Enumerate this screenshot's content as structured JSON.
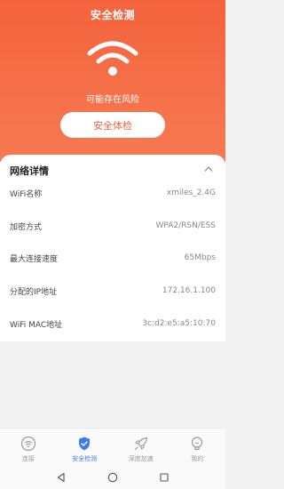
{
  "header": {
    "title": "安全检测",
    "status": "可能存在风险",
    "check_button": "安全体检"
  },
  "details": {
    "title": "网络详情",
    "rows": [
      {
        "key": "WiFi名称",
        "value": "xmiles_2.4G"
      },
      {
        "key": "加密方式",
        "value": "WPA2/RSN/ESS"
      },
      {
        "key": "最大连接速度",
        "value": "65Mbps"
      },
      {
        "key": "分配的IP地址",
        "value": "172.16.1.100"
      },
      {
        "key": "WiFi MAC地址",
        "value": "3c:d2:e5:a5:10:70"
      }
    ]
  },
  "tabs": [
    {
      "label": "连接",
      "icon": "wifi-circle-icon",
      "active": false
    },
    {
      "label": "安全检测",
      "icon": "shield-check-icon",
      "active": true
    },
    {
      "label": "深度加速",
      "icon": "rocket-icon",
      "active": false
    },
    {
      "label": "我的",
      "icon": "bulb-icon",
      "active": false
    }
  ],
  "colors": {
    "accent": "#f4633d",
    "active_tab": "#3d7cf0"
  }
}
